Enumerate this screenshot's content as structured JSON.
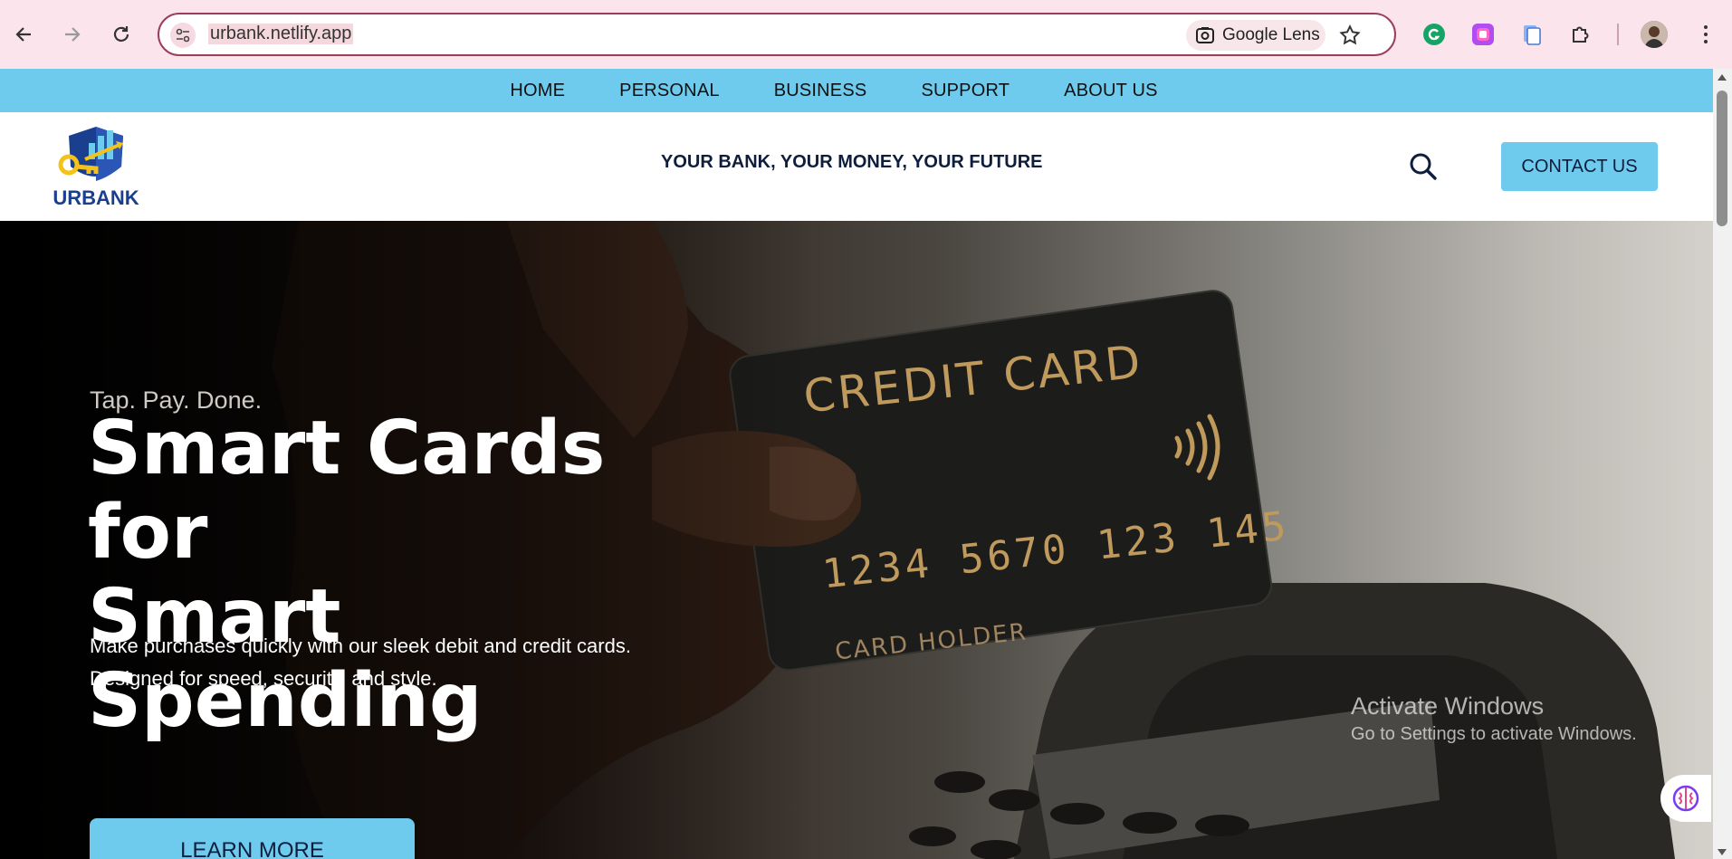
{
  "browser": {
    "url": "urbank.netlify.app",
    "lens_label": "Google Lens",
    "icons": [
      "back-icon",
      "forward-icon",
      "reload-icon",
      "site-info-icon",
      "lens-icon",
      "star-icon",
      "grammarly-icon",
      "extension-purple-icon",
      "extension-copy-icon",
      "extensions-puzzle-icon",
      "profile-avatar",
      "menu-icon"
    ]
  },
  "nav": {
    "items": [
      "HOME",
      "PERSONAL",
      "BUSINESS",
      "SUPPORT",
      "ABOUT US"
    ]
  },
  "header": {
    "logo_text": "URBANK",
    "tagline": "YOUR BANK, YOUR MONEY, YOUR FUTURE",
    "contact_label": "CONTACT US"
  },
  "hero": {
    "eyebrow": "Tap. Pay. Done.",
    "headline_line1": "Smart Cards for",
    "headline_line2": "Smart",
    "headline_line3": "Spending",
    "desc_line1": "Make purchases quickly with our sleek debit and credit cards.",
    "desc_line2": "Designed for speed, security, and style.",
    "button_label": "LEARN MORE",
    "card_title": "CREDIT CARD",
    "card_number": "1234 5670 123 145",
    "card_holder": "CARD HOLDER"
  },
  "overlay": {
    "activate_title": "Activate Windows",
    "activate_sub": "Go to Settings to activate Windows."
  },
  "colors": {
    "accent": "#6ecbee",
    "chrome_bg": "#fce4ec",
    "omnibox_border": "#9a3e5a",
    "brand_blue": "#1b3f8f"
  }
}
